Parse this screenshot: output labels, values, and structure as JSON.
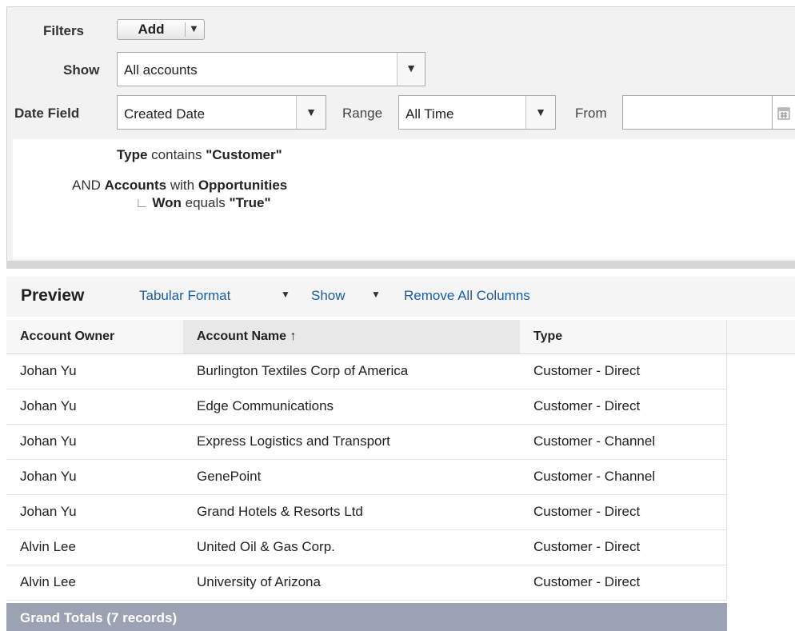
{
  "filters": {
    "filters_label": "Filters",
    "add_button": "Add",
    "show_label": "Show",
    "show_value": "All accounts",
    "date_field_label": "Date Field",
    "date_field_value": "Created Date",
    "range_label": "Range",
    "range_value": "All Time",
    "from_label": "From",
    "from_value": ""
  },
  "logic": {
    "line1": {
      "field": "Type",
      "op": "contains",
      "value": "\"Customer\""
    },
    "line2": {
      "prefix": "AND",
      "object": "Accounts",
      "with": "with",
      "related": "Opportunities"
    },
    "line3": {
      "branch": "∟",
      "field": "Won",
      "op": "equals",
      "value": "\"True\""
    }
  },
  "preview": {
    "title": "Preview",
    "format_link": "Tabular Format",
    "show_link": "Show",
    "remove_link": "Remove All Columns",
    "columns": [
      "Account Owner",
      "Account Name ↑",
      "Type"
    ],
    "rows": [
      {
        "owner": "Johan Yu",
        "name": "Burlington Textiles Corp of America",
        "type": "Customer - Direct"
      },
      {
        "owner": "Johan Yu",
        "name": "Edge Communications",
        "type": "Customer - Direct"
      },
      {
        "owner": "Johan Yu",
        "name": "Express Logistics and Transport",
        "type": "Customer - Channel"
      },
      {
        "owner": "Johan Yu",
        "name": "GenePoint",
        "type": "Customer - Channel"
      },
      {
        "owner": "Johan Yu",
        "name": "Grand Hotels & Resorts Ltd",
        "type": "Customer - Direct"
      },
      {
        "owner": "Alvin Lee",
        "name": "United Oil & Gas Corp.",
        "type": "Customer - Direct"
      },
      {
        "owner": "Alvin Lee",
        "name": "University of Arizona",
        "type": "Customer - Direct"
      }
    ],
    "grand_totals": "Grand Totals (7 records)"
  },
  "icons": {
    "dropdown": "chevron-down-icon",
    "calendar": "calendar-icon",
    "sort": "sort-ascending-icon"
  }
}
